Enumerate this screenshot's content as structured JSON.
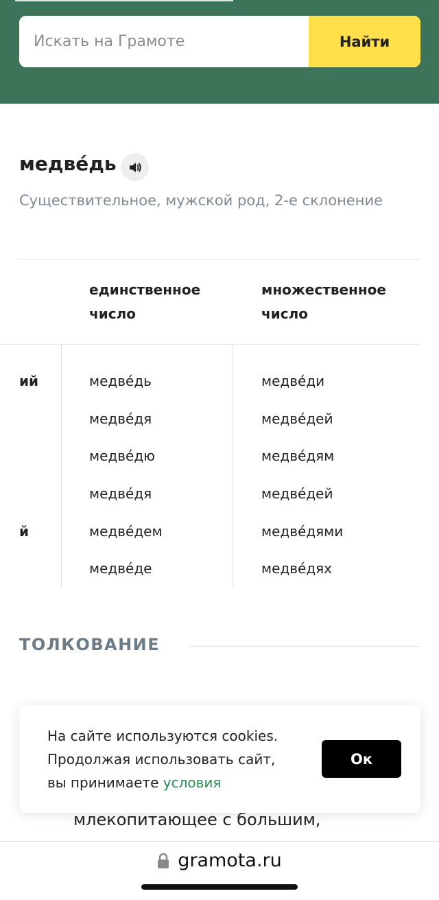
{
  "search": {
    "placeholder": "Искать на Грамоте",
    "button_label": "Найти"
  },
  "word": {
    "title": "медве́дь",
    "grammar": "Существительное, мужской род, 2-е склонение"
  },
  "declension": {
    "columns": [
      "единственное число",
      "множественное число"
    ],
    "case_fragments": [
      "ий",
      "й"
    ],
    "rows": [
      {
        "singular": "медве́дь",
        "plural": "медве́ди"
      },
      {
        "singular": "медве́дя",
        "plural": "медве́дей"
      },
      {
        "singular": "медве́дю",
        "plural": "медве́дям"
      },
      {
        "singular": "медве́дя",
        "plural": "медве́дей"
      },
      {
        "singular": "медве́дем",
        "plural": "медве́дями"
      },
      {
        "singular": "медве́де",
        "plural": "медве́дях"
      }
    ]
  },
  "interpretation": {
    "section_title": "ТОЛКОВАНИЕ",
    "visible_text": "млекопитающее с большим,"
  },
  "cookie": {
    "text_line1": "На сайте используются cookies.",
    "text_line2": "Продолжая использовать сайт,",
    "text_line3_prefix": "вы принимаете ",
    "link_label": "условия",
    "ok_label": "Ок"
  },
  "browser": {
    "url": "gramota.ru"
  },
  "colors": {
    "header_bg": "#3d7359",
    "search_button_bg": "#ffe04a",
    "link": "#2c8a55",
    "muted": "#808a94"
  },
  "icons": {
    "audio": "speaker-icon",
    "lock": "lock-icon"
  }
}
